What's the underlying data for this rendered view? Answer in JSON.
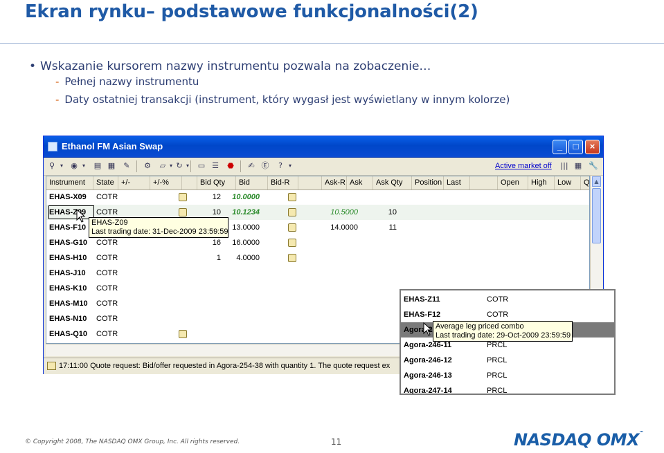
{
  "slide": {
    "title": "Ekran rynku– podstawowe funkcjonalności(2)",
    "bullet": "Wskazanie kursorem nazwy instrumentu pozwala na zobaczenie…",
    "sub1": "Pełnej nazwy instrumentu",
    "sub2": "Daty ostatniej transakcji (instrument, który wygasł jest wyświetlany w innym kolorze)",
    "dash": "-",
    "bullet_dot": "•"
  },
  "window": {
    "title": "Ethanol FM Asian Swap",
    "active_market_link": "Active market off",
    "columns": [
      "Instrument",
      "State",
      "+/-",
      "+/-%",
      "",
      "Bid Qty",
      "Bid",
      "Bid-R",
      "",
      "Ask-R",
      "Ask",
      "Ask Qty",
      "Position",
      "Last",
      "",
      "Open",
      "High",
      "Low",
      "Quantity"
    ],
    "rows": [
      {
        "instrument": "EHAS-X09",
        "state": "COTR",
        "bid_qty": "12",
        "bid": "10.0000",
        "ask": "",
        "ask_qty": ""
      },
      {
        "instrument": "EHAS-Z09",
        "state": "COTR",
        "bid_qty": "10",
        "bid": "10.1234",
        "ask": "10.5000",
        "ask_qty": "10"
      },
      {
        "instrument": "EHAS-F10",
        "state": "",
        "bid_qty": "",
        "bid": "13.0000",
        "ask": "14.0000",
        "ask_qty": "11"
      },
      {
        "instrument": "EHAS-G10",
        "state": "COTR",
        "bid_qty": "16",
        "bid": "16.0000",
        "ask": "",
        "ask_qty": ""
      },
      {
        "instrument": "EHAS-H10",
        "state": "COTR",
        "bid_qty": "1",
        "bid": "4.0000",
        "ask": "",
        "ask_qty": ""
      },
      {
        "instrument": "EHAS-J10",
        "state": "COTR",
        "bid_qty": "",
        "bid": "",
        "ask": "",
        "ask_qty": ""
      },
      {
        "instrument": "EHAS-K10",
        "state": "COTR",
        "bid_qty": "",
        "bid": "",
        "ask": "",
        "ask_qty": ""
      },
      {
        "instrument": "EHAS-M10",
        "state": "COTR",
        "bid_qty": "",
        "bid": "",
        "ask": "",
        "ask_qty": ""
      },
      {
        "instrument": "EHAS-N10",
        "state": "COTR",
        "bid_qty": "",
        "bid": "",
        "ask": "",
        "ask_qty": ""
      },
      {
        "instrument": "EHAS-Q10",
        "state": "COTR",
        "bid_qty": "",
        "bid": "",
        "ask": "",
        "ask_qty": ""
      }
    ],
    "tooltip": {
      "line1": "EHAS-Z09",
      "line2": "Last trading date: 31-Dec-2009 23:59:59"
    },
    "status": {
      "time": "17:11:00",
      "text": "Quote request: Bid/offer requested in Agora-254-38 with quantity 1. The quote request ex"
    }
  },
  "inset": {
    "rows": [
      {
        "name": "EHAS-Z11",
        "state": "COTR"
      },
      {
        "name": "EHAS-F12",
        "state": "COTR"
      },
      {
        "name": "Agora-2",
        "state": ""
      },
      {
        "name": "Agora-246-11",
        "state": "PRCL"
      },
      {
        "name": "Agora-246-12",
        "state": "PRCL"
      },
      {
        "name": "Agora-246-13",
        "state": "PRCL"
      },
      {
        "name": "Agora-247-14",
        "state": "PRCL"
      }
    ],
    "tooltip": {
      "line1": "Average leg priced combo",
      "line2": "Last trading date: 29-Oct-2009 23:59:59"
    }
  },
  "footer": {
    "copyright": "© Copyright 2008, The NASDAQ OMX Group, Inc. All rights reserved.",
    "page_number": "11",
    "logo": "NASDAQ OMX",
    "logo_tm": "™"
  },
  "colors": {
    "title": "#1f5aa6",
    "text": "#2d3e73",
    "green": "#2a8a2a",
    "xp_blue": "#0047c9"
  }
}
